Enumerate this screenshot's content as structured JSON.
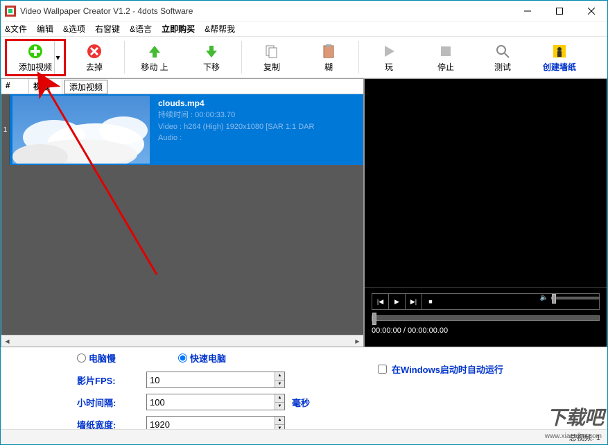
{
  "title": "Video Wallpaper Creator V1.2 - 4dots Software",
  "menu": {
    "file": "&文件",
    "edit": "编辑",
    "options": "&选项",
    "rightkey": "右窗键",
    "language": "&语言",
    "buy": "立即购买",
    "help": "&帮帮我"
  },
  "toolbar": {
    "add": "添加视频",
    "remove": "去掉",
    "moveup": "移动 上",
    "movedown": "下移",
    "copy": "复制",
    "paste": "糊",
    "play": "玩",
    "stop": "停止",
    "test": "测试",
    "create": "创建墙纸"
  },
  "tooltip": "添加视频",
  "list": {
    "col_num": "#",
    "col_video": "视频",
    "row_index": "1",
    "filename": "clouds.mp4",
    "duration_line": "持续时间 : 00:00:33.70",
    "video_line": "Video : h264 (High) 1920x1080 [SAR 1:1 DAR",
    "audio_line": "Audio :"
  },
  "player": {
    "timecode": "00:00:00 / 00:00:00.00"
  },
  "settings": {
    "radio_slow": "电脑慢",
    "radio_fast": "快速电脑",
    "fps_label": "影片FPS:",
    "fps_value": "10",
    "interval_label": "小时间隔:",
    "interval_value": "100",
    "interval_unit": "毫秒",
    "width_label": "墙纸宽度:",
    "width_value": "1920",
    "autorun": "在Windows启动时自动运行"
  },
  "status": {
    "total_videos": "总视频: 1"
  },
  "watermark": {
    "text": "下载吧",
    "url": "www.xiazaiba.com"
  }
}
